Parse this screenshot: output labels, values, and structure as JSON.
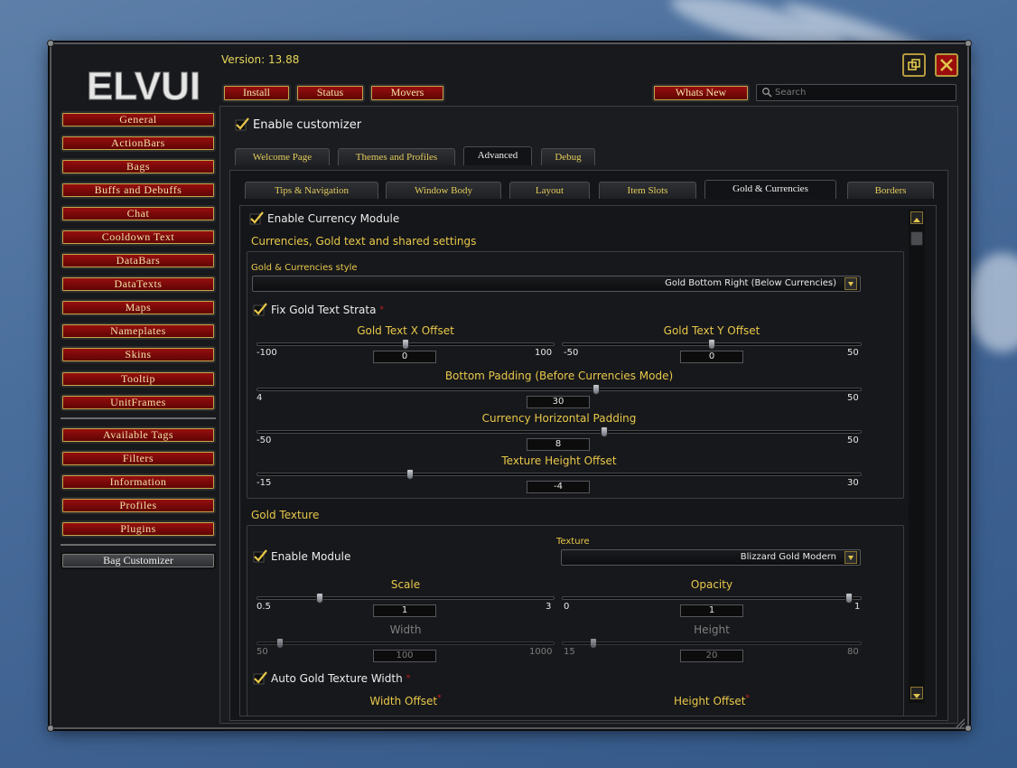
{
  "app": {
    "logo_text": "ELVUI",
    "version": "Version: 13.88"
  },
  "top_buttons": {
    "install": "Install",
    "status": "Status",
    "movers": "Movers",
    "whats_new": "Whats New"
  },
  "search": {
    "placeholder": "Search"
  },
  "sidebar": {
    "items": [
      "General",
      "ActionBars",
      "Bags",
      "Buffs and Debuffs",
      "Chat",
      "Cooldown Text",
      "DataBars",
      "DataTexts",
      "Maps",
      "Nameplates",
      "Skins",
      "Tooltip",
      "UnitFrames"
    ],
    "extras": [
      "Available Tags",
      "Filters",
      "Information",
      "Profiles",
      "Plugins"
    ],
    "plugin_item": "Bag Customizer"
  },
  "main": {
    "enable_customizer": "Enable customizer",
    "tabs": [
      "Welcome Page",
      "Themes and Profiles",
      "Advanced",
      "Debug"
    ],
    "active_tab": "Advanced",
    "subtabs": [
      "Tips & Navigation",
      "Window Body",
      "Layout",
      "Item Slots",
      "Gold & Currencies",
      "Borders"
    ],
    "active_subtab": "Gold & Currencies"
  },
  "currency": {
    "enable_label": "Enable Currency Module",
    "section_title": "Currencies, Gold text and shared settings",
    "style_label": "Gold & Currencies style",
    "style_value": "Gold Bottom Right (Below Currencies)",
    "fix_strata_label": "Fix Gold Text Strata",
    "gold_x": {
      "label": "Gold Text X Offset",
      "min": "-100",
      "max": "100",
      "value": "0",
      "fraction": 0.5
    },
    "gold_y": {
      "label": "Gold Text Y Offset",
      "min": "-50",
      "max": "50",
      "value": "0",
      "fraction": 0.5
    },
    "bottom_padding": {
      "label": "Bottom Padding (Before Currencies Mode)",
      "min": "4",
      "max": "50",
      "value": "30",
      "fraction": 0.565
    },
    "horiz_padding": {
      "label": "Currency Horizontal Padding",
      "min": "-50",
      "max": "50",
      "value": "8",
      "fraction": 0.58
    },
    "texture_height": {
      "label": "Texture Height Offset",
      "min": "-15",
      "max": "30",
      "value": "-4",
      "fraction": 0.244
    }
  },
  "gold_texture": {
    "section_title": "Gold Texture",
    "enable_label": "Enable Module",
    "texture_label": "Texture",
    "texture_value": "Blizzard Gold Modern",
    "scale": {
      "label": "Scale",
      "min": "0.5",
      "max": "3",
      "value": "1",
      "fraction": 0.2
    },
    "opacity": {
      "label": "Opacity",
      "min": "0",
      "max": "1",
      "value": "1",
      "fraction": 1.0
    },
    "width": {
      "label": "Width",
      "min": "50",
      "max": "1000",
      "value": "100",
      "fraction": 0.053
    },
    "height": {
      "label": "Height",
      "min": "15",
      "max": "80",
      "value": "20",
      "fraction": 0.077
    },
    "auto_width_label": "Auto Gold Texture Width",
    "width_offset_label": "Width Offset",
    "height_offset_label": "Height Offset"
  },
  "colors": {
    "accent_gold": "#e8c84a",
    "button_red": "#8a0b0b",
    "version_text": "#e8d55a"
  }
}
